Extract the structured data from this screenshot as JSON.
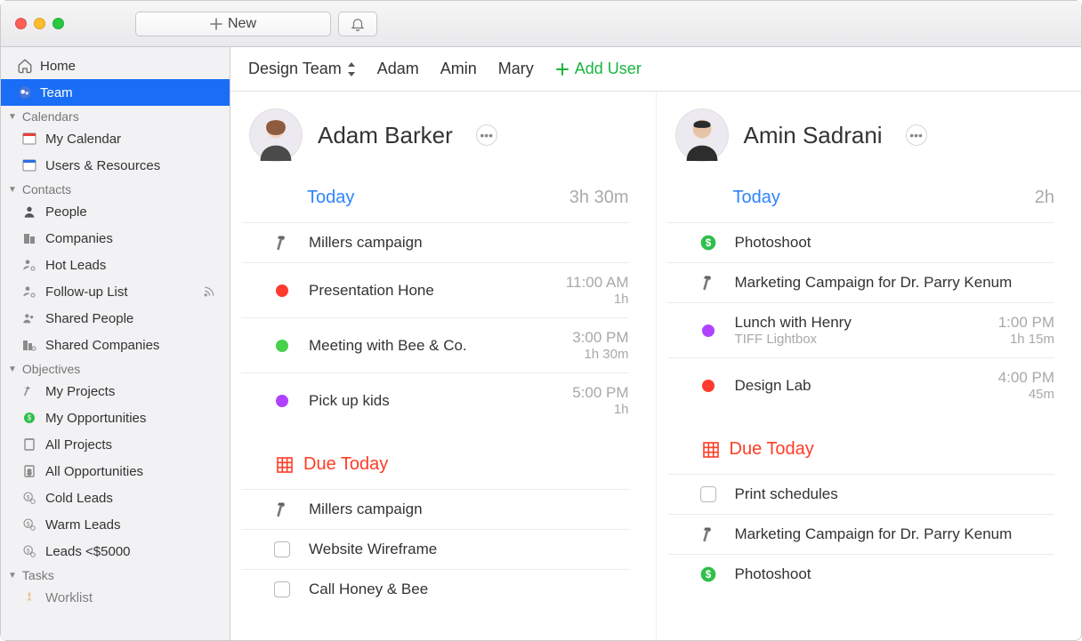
{
  "toolbar": {
    "new_label": "New"
  },
  "sidebar": {
    "top": [
      {
        "label": "Home",
        "icon": "home"
      },
      {
        "label": "Team",
        "icon": "team",
        "selected": true
      }
    ],
    "groups": [
      {
        "label": "Calendars",
        "items": [
          {
            "label": "My Calendar",
            "icon": "calendar-red"
          },
          {
            "label": "Users & Resources",
            "icon": "calendar-blue"
          }
        ]
      },
      {
        "label": "Contacts",
        "items": [
          {
            "label": "People",
            "icon": "person"
          },
          {
            "label": "Companies",
            "icon": "building"
          },
          {
            "label": "Hot Leads",
            "icon": "person-gear"
          },
          {
            "label": "Follow-up List",
            "icon": "person-gear",
            "aux": "rss"
          },
          {
            "label": "Shared People",
            "icon": "person-share"
          },
          {
            "label": "Shared Companies",
            "icon": "building-share"
          }
        ]
      },
      {
        "label": "Objectives",
        "items": [
          {
            "label": "My Projects",
            "icon": "hammer"
          },
          {
            "label": "My Opportunities",
            "icon": "dollar-green"
          },
          {
            "label": "All Projects",
            "icon": "notebook"
          },
          {
            "label": "All Opportunities",
            "icon": "notebook-dollar"
          },
          {
            "label": "Cold Leads",
            "icon": "dollar-gear"
          },
          {
            "label": "Warm Leads",
            "icon": "dollar-gear"
          },
          {
            "label": "Leads <$5000",
            "icon": "dollar-gear"
          }
        ]
      },
      {
        "label": "Tasks",
        "items": [
          {
            "label": "Worklist",
            "icon": "pin"
          }
        ]
      }
    ]
  },
  "header": {
    "team": "Design Team",
    "users": [
      "Adam",
      "Amin",
      "Mary"
    ],
    "add_user_label": "Add User"
  },
  "columns": [
    {
      "name": "Adam Barker",
      "today_label": "Today",
      "today_total": "3h 30m",
      "today": [
        {
          "icon": "hammer",
          "title": "Millers campaign"
        },
        {
          "icon": "dot-red",
          "title": "Presentation Hone",
          "time": "11:00 AM",
          "dur": "1h"
        },
        {
          "icon": "dot-green",
          "title": "Meeting with Bee & Co.",
          "time": "3:00 PM",
          "dur": "1h 30m"
        },
        {
          "icon": "dot-purple",
          "title": "Pick up kids",
          "time": "5:00 PM",
          "dur": "1h"
        }
      ],
      "due_label": "Due Today",
      "due": [
        {
          "icon": "hammer",
          "title": "Millers campaign"
        },
        {
          "icon": "checkbox",
          "title": "Website Wireframe"
        },
        {
          "icon": "checkbox",
          "title": "Call Honey & Bee"
        }
      ]
    },
    {
      "name": "Amin Sadrani",
      "today_label": "Today",
      "today_total": "2h",
      "today": [
        {
          "icon": "dollar-green",
          "title": "Photoshoot"
        },
        {
          "icon": "hammer",
          "title": "Marketing Campaign for Dr. Parry Kenum"
        },
        {
          "icon": "dot-purple",
          "title": "Lunch with Henry",
          "sub": "TIFF Lightbox",
          "time": "1:00 PM",
          "dur": "1h 15m"
        },
        {
          "icon": "dot-red",
          "title": "Design Lab",
          "time": "4:00 PM",
          "dur": "45m"
        }
      ],
      "due_label": "Due Today",
      "due": [
        {
          "icon": "checkbox",
          "title": "Print schedules"
        },
        {
          "icon": "hammer",
          "title": "Marketing Campaign for Dr. Parry Kenum"
        },
        {
          "icon": "dollar-green",
          "title": "Photoshoot"
        }
      ]
    }
  ]
}
